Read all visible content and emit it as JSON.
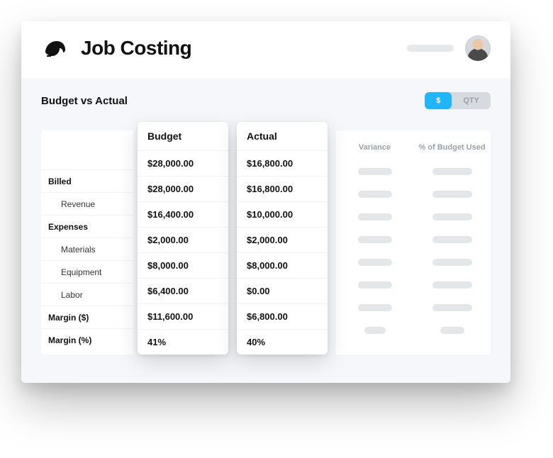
{
  "header": {
    "title": "Job Costing"
  },
  "section": {
    "title": "Budget vs Actual",
    "toggle": {
      "dollar": "$",
      "qty": "QTY"
    }
  },
  "labels": {
    "billed": "Billed",
    "revenue": "Revenue",
    "expenses": "Expenses",
    "materials": "Materials",
    "equipment": "Equipment",
    "labor": "Labor",
    "margin_dollar": "Margin ($)",
    "margin_pct": "Margin (%)"
  },
  "columns": {
    "budget": {
      "header": "Budget",
      "billed": "$28,000.00",
      "revenue": "$28,000.00",
      "expenses": "$16,400.00",
      "materials": "$2,000.00",
      "equipment": "$8,000.00",
      "labor": "$6,400.00",
      "margin_dollar": "$11,600.00",
      "margin_pct": "41%"
    },
    "actual": {
      "header": "Actual",
      "billed": "$16,800.00",
      "revenue": "$16,800.00",
      "expenses": "$10,000.00",
      "materials": "$2,000.00",
      "equipment": "$8,000.00",
      "labor": "$0.00",
      "margin_dollar": "$6,800.00",
      "margin_pct": "40%"
    },
    "variance_header": "Variance",
    "pct_used_header": "% of Budget Used"
  }
}
